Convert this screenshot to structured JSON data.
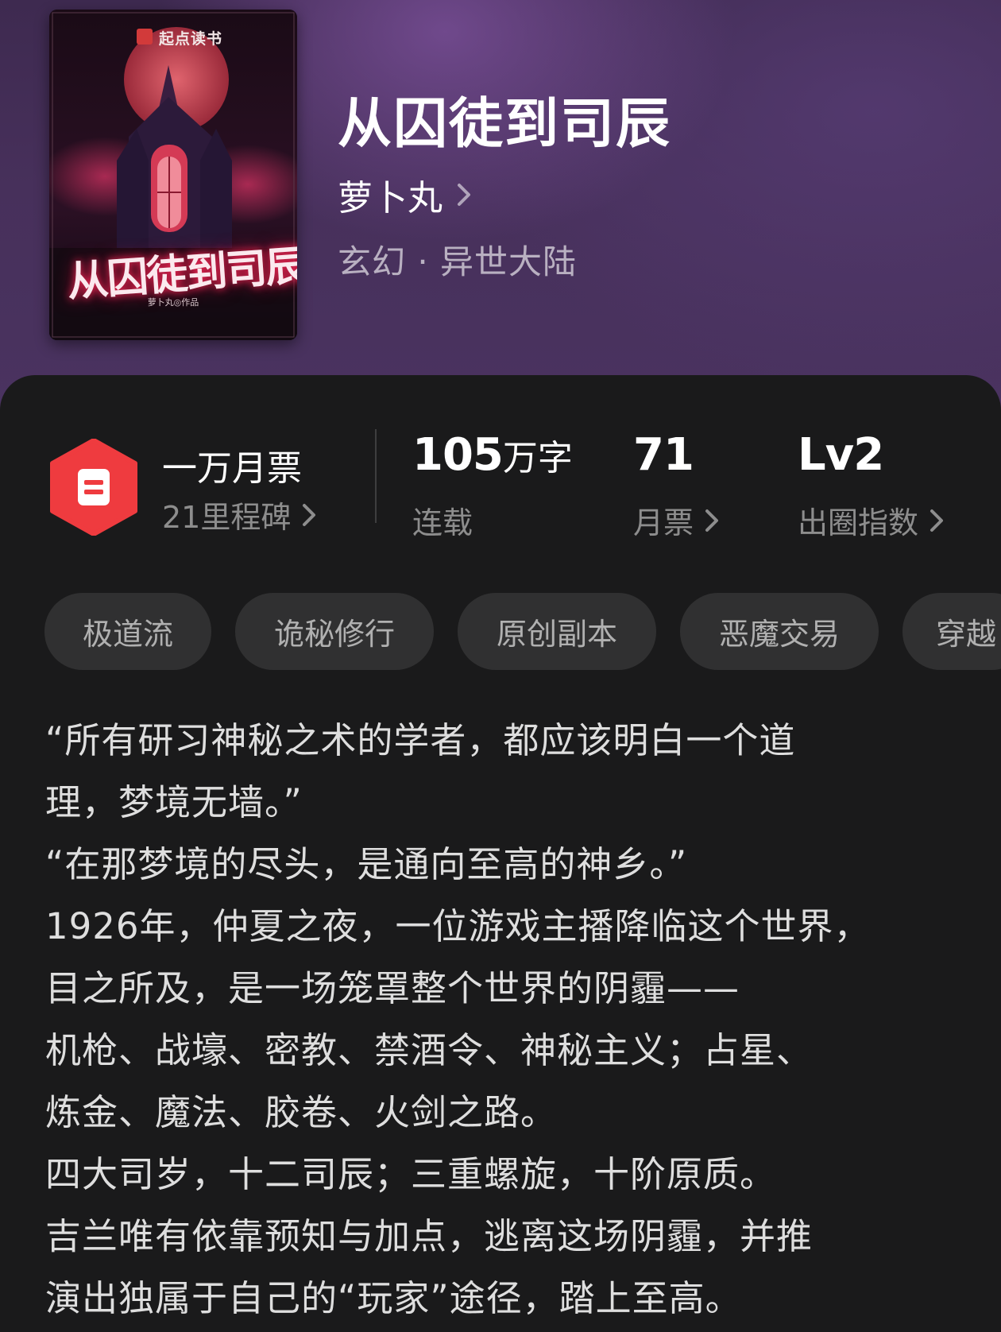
{
  "cover": {
    "brand": "起点读书",
    "title": "从囚徒到司辰",
    "author_line": "萝卜丸◎作品"
  },
  "book": {
    "title": "从囚徒到司辰",
    "author": "萝卜丸",
    "genre": "玄幻 · 异世大陆"
  },
  "stats": {
    "badge_title": "一万月票",
    "badge_sub": "21里程碑",
    "word_count": "105",
    "word_unit": "万字",
    "status": "连载",
    "monthly_votes": "71",
    "monthly_votes_label": "月票",
    "level": "Lv2",
    "level_label": "出圈指数"
  },
  "tags": [
    "极道流",
    "诡秘修行",
    "原创副本",
    "恶魔交易",
    "穿越"
  ],
  "synopsis": [
    "“所有研习神秘之术的学者，都应该明白一个道",
    "理，梦境无墙。”",
    "“在那梦境的尽头，是通向至高的神乡。”",
    "1926年，仲夏之夜，一位游戏主播降临这个世界，",
    "目之所及，是一场笼罩整个世界的阴霾——",
    "机枪、战壕、密教、禁酒令、神秘主义；占星、",
    "炼金、魔法、胶卷、火剑之路。",
    "四大司岁，十二司辰；三重螺旋，十阶原质。",
    "吉兰唯有依靠预知与加点，逃离这场阴霾，并推",
    "演出独属于自己的“玩家”途径，踏上至高。"
  ],
  "colors": {
    "header_purple": "#47305b",
    "panel_bg": "#1a1a1b",
    "badge_red": "#ef3b3f",
    "tag_bg": "#303031"
  }
}
